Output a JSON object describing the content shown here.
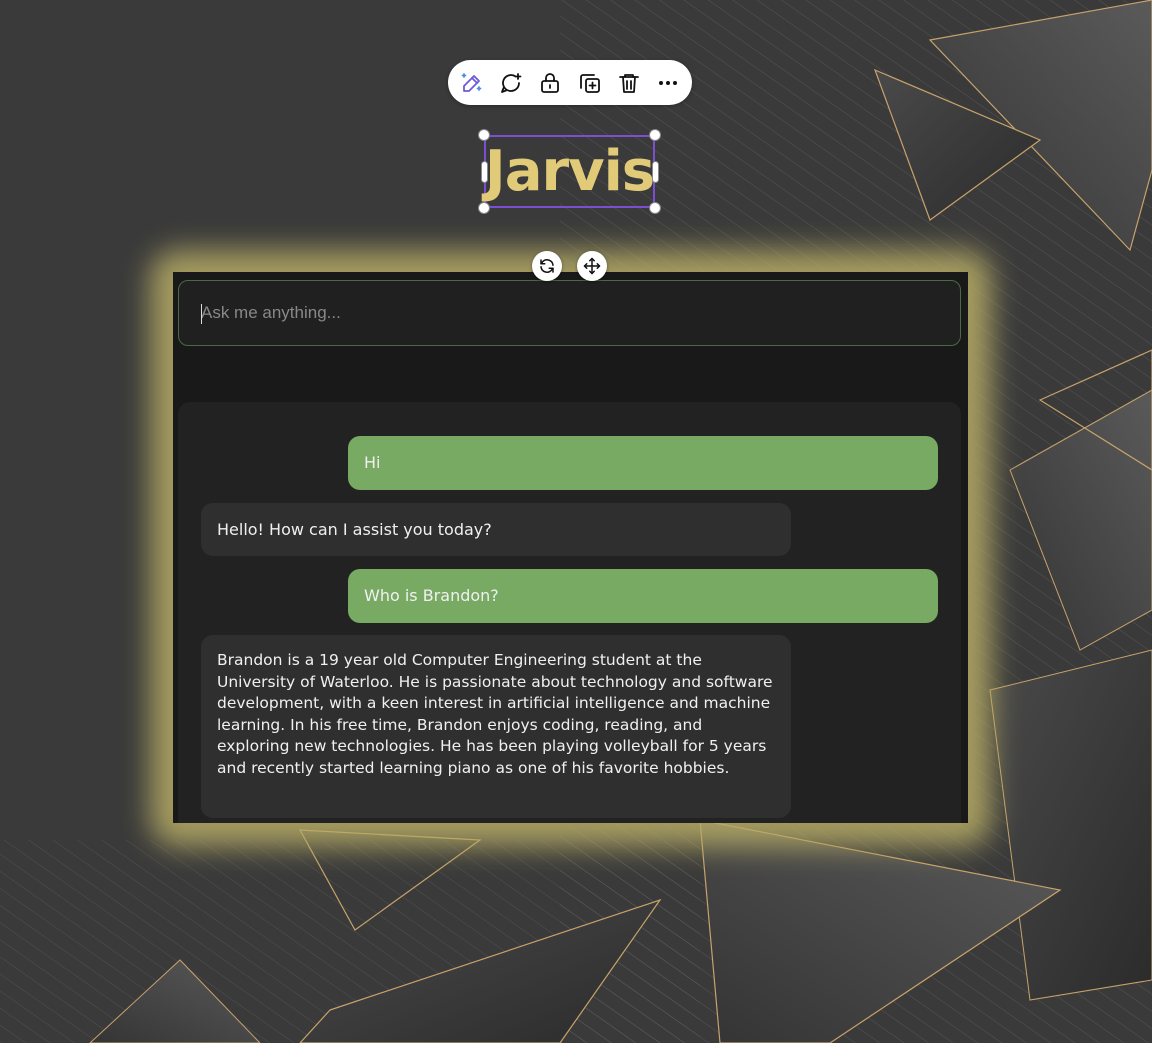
{
  "toolbar": {
    "icons": [
      "magic-edit-icon",
      "add-comment-icon",
      "lock-icon",
      "duplicate-icon",
      "trash-icon",
      "more-icon"
    ]
  },
  "title": {
    "text": "Jarvis",
    "color": "#e1cb79"
  },
  "element_controls": {
    "icons": [
      "rotate-icon",
      "move-icon"
    ]
  },
  "chat": {
    "input_placeholder": "Ask me anything...",
    "messages": [
      {
        "role": "user",
        "text": "Hi"
      },
      {
        "role": "assistant",
        "text": "Hello! How can I assist you today?"
      },
      {
        "role": "user",
        "text": "Who is Brandon?"
      },
      {
        "role": "assistant",
        "text": "Brandon is a 19 year old Computer Engineering student at the University of Waterloo. He is passionate about technology and software development, with a keen interest in artificial intelligence and machine learning. In his free time, Brandon enjoys coding, reading, and exploring new technologies. He has been playing volleyball for 5 years and recently started learning piano as one of his favorite hobbies."
      }
    ]
  },
  "colors": {
    "accent": "#7b4fd1",
    "user_bubble": "#78aa63",
    "assistant_bubble": "#2f2f2f",
    "glow": "#b7ac66",
    "background": "#3b3b3b"
  }
}
